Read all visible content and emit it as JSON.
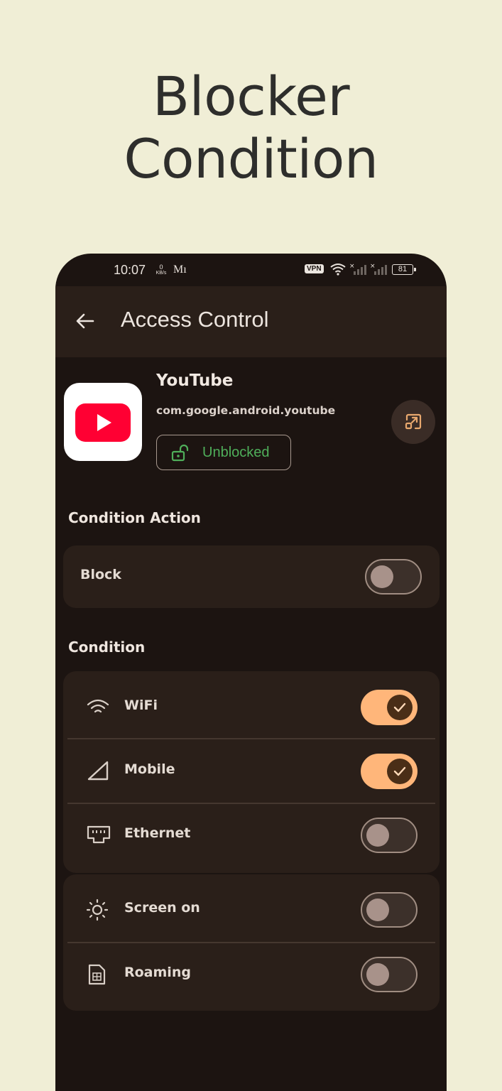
{
  "hero": {
    "line1": "Blocker",
    "line2": "Condition"
  },
  "status_bar": {
    "time": "10:07",
    "speed_value": "0",
    "speed_unit": "KB/s",
    "carrier": "Mı",
    "vpn": "VPN",
    "battery": "81"
  },
  "app_bar": {
    "title": "Access Control",
    "back_icon": "arrow-left-icon"
  },
  "app": {
    "name": "YouTube",
    "package": "com.google.android.youtube",
    "status": "Unblocked",
    "status_color": "#4fae5a",
    "open_icon": "open-in-app-icon"
  },
  "condition_action": {
    "title": "Condition Action",
    "block": {
      "label": "Block",
      "enabled": false
    }
  },
  "condition": {
    "title": "Condition",
    "items": [
      {
        "label": "WiFi",
        "icon": "wifi-icon",
        "enabled": true
      },
      {
        "label": "Mobile",
        "icon": "cellular-icon",
        "enabled": true
      },
      {
        "label": "Ethernet",
        "icon": "ethernet-icon",
        "enabled": false
      },
      {
        "label": "Screen on",
        "icon": "brightness-icon",
        "enabled": false
      },
      {
        "label": "Roaming",
        "icon": "sim-card-icon",
        "enabled": false
      }
    ]
  },
  "colors": {
    "background": "#f0eed6",
    "phone_bg": "#1c1411",
    "card_bg": "#2a1f19",
    "switch_on": "#ffb67a",
    "brand_red": "#ff0033"
  }
}
